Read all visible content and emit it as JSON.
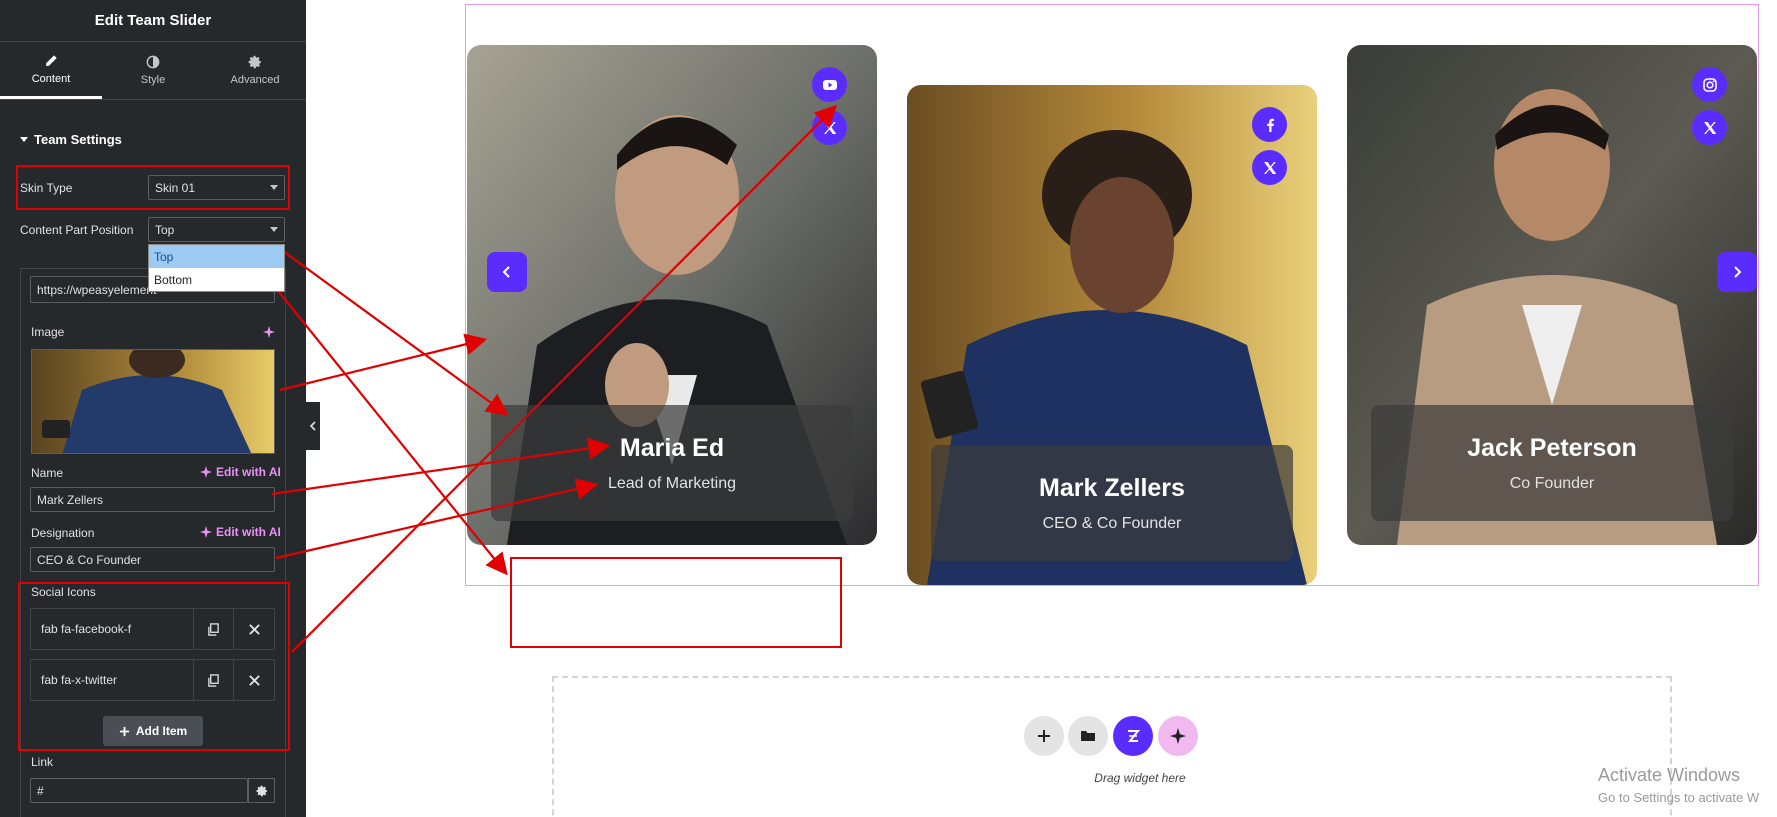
{
  "panel": {
    "title": "Edit Team Slider",
    "tabs": [
      {
        "label": "Content",
        "icon": "pencil-icon",
        "active": true
      },
      {
        "label": "Style",
        "icon": "contrast-icon",
        "active": false
      },
      {
        "label": "Advanced",
        "icon": "gear-icon",
        "active": false
      }
    ],
    "section_title": "Team Settings",
    "skin_type": {
      "label": "Skin Type",
      "value": "Skin 01"
    },
    "content_position": {
      "label": "Content Part Position",
      "value": "Top",
      "options": [
        "Top",
        "Bottom"
      ],
      "highlighted": "Top"
    },
    "url_value": "https://wpeasyelement",
    "image_label": "Image",
    "name": {
      "label": "Name",
      "value": "Mark Zellers",
      "ai_label": "Edit with AI"
    },
    "designation": {
      "label": "Designation",
      "value": "CEO & Co Founder",
      "ai_label": "Edit with AI"
    },
    "social_icons": {
      "label": "Social Icons",
      "items": [
        "fab fa-facebook-f",
        "fab fa-x-twitter"
      ],
      "add_label": "Add Item"
    },
    "link": {
      "label": "Link",
      "value": "#"
    }
  },
  "cards": [
    {
      "name": "Maria Ed",
      "role": "Lead of Marketing",
      "icons": [
        "youtube-icon",
        "x-twitter-icon"
      ]
    },
    {
      "name": "Mark Zellers",
      "role": "CEO & Co Founder",
      "icons": [
        "facebook-icon",
        "x-twitter-icon"
      ]
    },
    {
      "name": "Jack Peterson",
      "role": "Co Founder",
      "icons": [
        "instagram-icon",
        "x-twitter-icon"
      ]
    }
  ],
  "dropzone": {
    "text": "Drag widget here"
  },
  "watermark": {
    "line1": "Activate Windows",
    "line2": "Go to Settings to activate W"
  },
  "colors": {
    "accent": "#5b2cff",
    "annotation": "#e00000",
    "panel_bg": "#26292c"
  }
}
